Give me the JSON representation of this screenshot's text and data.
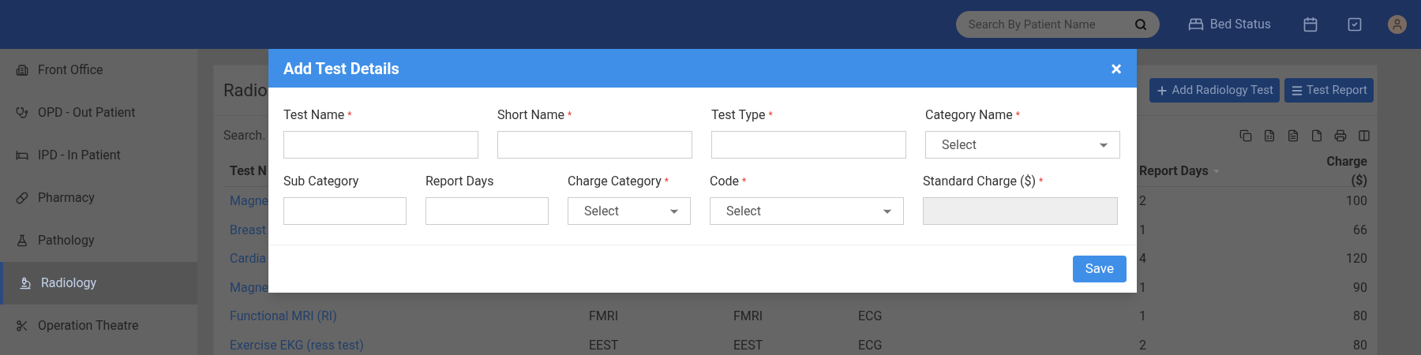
{
  "header": {
    "search": {
      "placeholder": "Search By Patient Name"
    },
    "bed_status": "Bed Status"
  },
  "sidebar": {
    "items": [
      {
        "label": "Front Office",
        "selected": false
      },
      {
        "label": "OPD - Out Patient",
        "selected": false
      },
      {
        "label": "IPD - In Patient",
        "selected": false
      },
      {
        "label": "Pharmacy",
        "selected": false
      },
      {
        "label": "Pathology",
        "selected": false
      },
      {
        "label": "Radiology",
        "selected": true
      },
      {
        "label": "Operation Theatre",
        "selected": false
      }
    ]
  },
  "panel": {
    "title": "Radio",
    "buttons": [
      "Add Radiology Test",
      "Test Report"
    ],
    "search": {
      "placeholder": "Search."
    },
    "table": {
      "columns": [
        "Test N",
        "Report Days",
        "Charge ($)"
      ],
      "rows": [
        {
          "name": "Magne",
          "report_days": "2",
          "charge": "100"
        },
        {
          "name": "Breast",
          "report_days": "1",
          "charge": "66"
        },
        {
          "name": "Cardia",
          "report_days": "4",
          "charge": "120"
        },
        {
          "name": "Magne",
          "report_days": "1",
          "charge": "90"
        },
        {
          "name": "Functional MRI (RI)",
          "column_2": "FMRI",
          "column_3": "FMRI",
          "column_4": "ECG",
          "report_days": "1",
          "charge": "80"
        },
        {
          "name": "Exercise EKG (ress test)",
          "column_2": "EEST",
          "column_3": "EEST",
          "column_4": "ECG",
          "report_days": "2",
          "charge": "80"
        }
      ]
    }
  },
  "modal": {
    "title": "Add Test Details",
    "close": "×",
    "fields": [
      {
        "label": "Test Name",
        "required_mark": "*",
        "kind": "text"
      },
      {
        "label": "Short Name",
        "required_mark": "*",
        "kind": "text"
      },
      {
        "label": "Test Type",
        "required_mark": "*",
        "kind": "text"
      },
      {
        "label": "Category Name",
        "required_mark": "*",
        "kind": "select",
        "value": "Select"
      },
      {
        "label": "Sub Category",
        "kind": "text"
      },
      {
        "label": "Report Days",
        "kind": "text"
      },
      {
        "label": "Charge Category",
        "required_mark": "*",
        "kind": "select",
        "value": "Select"
      },
      {
        "label": "Code",
        "required_mark": "*",
        "kind": "select",
        "value": "Select"
      },
      {
        "label": "Standard Charge ($)",
        "required_mark": "*",
        "kind": "disabled"
      }
    ],
    "save": "Save"
  }
}
